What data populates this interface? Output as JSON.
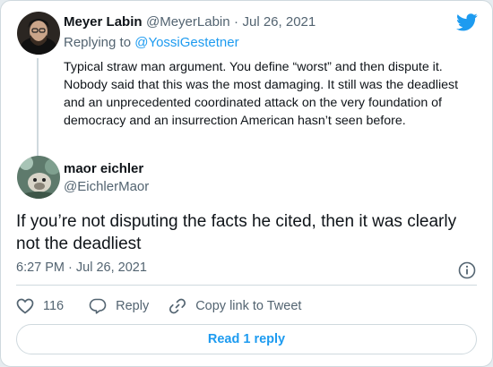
{
  "parent": {
    "name": "Meyer Labin",
    "handle": "@MeyerLabin",
    "separator": "·",
    "date": "Jul 26, 2021",
    "replying_prefix": "Replying to",
    "replying_to": "@YossiGestetner",
    "text": "Typical straw man argument. You define “worst” and then dispute it. Nobody said that this was the most damaging. It still was the deadliest and an unprecedented coordinated attack on the very foundation of democracy and an insurrection American hasn’t seen before."
  },
  "reply": {
    "name": "maor eichler",
    "handle": "@EichlerMaor",
    "text": "If you’re not disputing the facts he cited, then it was clearly not the deadliest",
    "timestamp": "6:27 PM · Jul 26, 2021"
  },
  "actions": {
    "like_count": "116",
    "reply_label": "Reply",
    "copy_label": "Copy link to Tweet"
  },
  "read_replies_label": "Read 1 reply",
  "colors": {
    "accent": "#1d9bf0",
    "muted": "#536471",
    "border": "#cfd9de"
  },
  "icons": [
    "twitter-bird-icon",
    "info-icon",
    "heart-icon",
    "reply-bubble-icon",
    "link-icon"
  ]
}
